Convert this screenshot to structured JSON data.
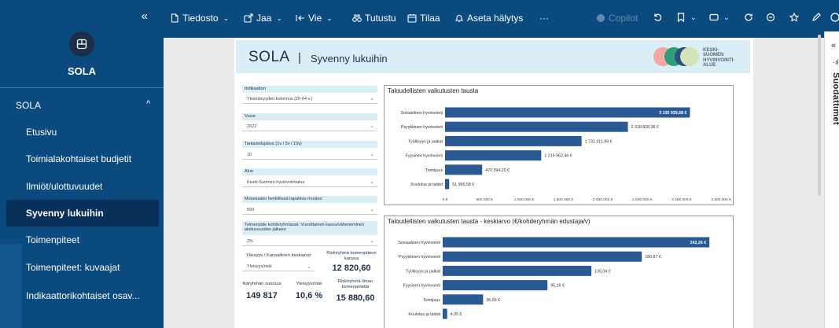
{
  "sidebar": {
    "collapse_glyph": "«",
    "app_name": "SOLA",
    "section": "SOLA",
    "items": [
      {
        "label": "Etusivu",
        "active": false
      },
      {
        "label": "Toimialakohtaiset budjetit",
        "active": false
      },
      {
        "label": "Ilmiöt/ulottuvuudet",
        "active": false
      },
      {
        "label": "Syvenny lukuihin",
        "active": true
      },
      {
        "label": "Toimenpiteet",
        "active": false
      },
      {
        "label": "Toimenpiteet: kuvaajat",
        "active": false
      },
      {
        "label": "Indikaattorikohtaiset osav...",
        "active": false
      }
    ]
  },
  "toolbar": {
    "file": "Tiedosto",
    "share": "Jaa",
    "export": "Vie",
    "explore": "Tutustu",
    "subscribe": "Tilaa",
    "alert": "Aseta hälytys",
    "more": "···",
    "copilot": "Copilot"
  },
  "report": {
    "title": "SOLA",
    "separator": "|",
    "subtitle": "Syvenny lukuihin",
    "logo_text": [
      "KESKI-",
      "SUOMEN",
      "HYVINVOINTI-",
      "ALUE"
    ],
    "filters": [
      {
        "label": "Indikaattori",
        "value": "Yksinäisyyden kokemus (20-64 v.)"
      },
      {
        "label": "Vuosi",
        "value": "2022"
      },
      {
        "label": "Tarkastelujakso (1v / 5v / 10v)",
        "value": "10"
      },
      {
        "label": "Alue",
        "value": "Keski-Suomen hyvinvointialue"
      },
      {
        "label": "Monessako henkilössä tapahtuu muutos:",
        "value": "500"
      },
      {
        "label": "Toimenpide kohderyhmässä: Vuosittainen kasvu/vähenem­inen aloitusvuoden jälkeen",
        "value": "2%"
      }
    ],
    "kpis": {
      "mode_label": "Yleisyys / Kansallinen keskiarvo",
      "mode_value": "Yleisyys/riski",
      "risk_with_label": "Riskiryhmä toimenpiteen kanssa",
      "risk_with_value": "12 820,60",
      "age_group_label": "Ikäryhmän suuruus",
      "age_group_value": "149 817",
      "prevalence_label": "Yleisyys/riski",
      "prevalence_value": "10,6 %",
      "risk_without_label": "Riskiryhmä ilman toimenpidettä",
      "risk_without_value": "15 880,60"
    }
  },
  "chart_data": [
    {
      "type": "bar",
      "orientation": "horizontal",
      "title": "Taloudellisten vaikutusten tausta",
      "categories": [
        "Sosiaalinen hyvinvointi",
        "Psyykkinen hyvinvointi",
        "Työllisyys ja palkat",
        "Fyysinen hyvinvointi",
        "Toimijuus",
        "Koulutus ja taidot"
      ],
      "values": [
        3105939.68,
        2318828.36,
        1731311.99,
        1219962.46,
        470394.2,
        51966.58
      ],
      "value_labels": [
        "3 105 939,68 €",
        "2 318 828,36 €",
        "1 731 311,99 €",
        "1 219 962,46 €",
        "470 394,20 €",
        "51 966,58 €"
      ],
      "xlim": [
        0,
        3500000
      ],
      "xticks": [
        "0 €",
        "500 000 €",
        "1 000 000 €",
        "1 500 000 €",
        "2 000 000 €",
        "2 500 000 €",
        "3 000 000 €",
        "3 500 000 €"
      ],
      "color": "#2a5a94"
    },
    {
      "type": "bar",
      "orientation": "horizontal",
      "title": "Taloudellisten vaikutusten tausta - keskiarvo (€/kohderyhmän edustaja/v)",
      "categories": [
        "Sosiaalinen hyvinvointi",
        "Psyykkinen hyvinvointi",
        "Työllisyys ja palkat",
        "Fyysinen hyvinvointi",
        "Toimijuus",
        "Koulutus ja taidot"
      ],
      "values": [
        242.26,
        180.87,
        135.04,
        95.16,
        36.69,
        4.05
      ],
      "value_labels": [
        "242,26 €",
        "180,87 €",
        "135,04 €",
        "95,16 €",
        "36,69 €",
        "4,05 €"
      ],
      "xlim": [
        0,
        250
      ],
      "color": "#2a5a94"
    }
  ],
  "right_pane": {
    "collapse_glyph": "«",
    "label": "Suodattimet"
  },
  "colors": {
    "sidebar": "#0b4a7f",
    "active_item": "#08305a",
    "header_band": "#dbeef6",
    "bar": "#2a5a94"
  }
}
